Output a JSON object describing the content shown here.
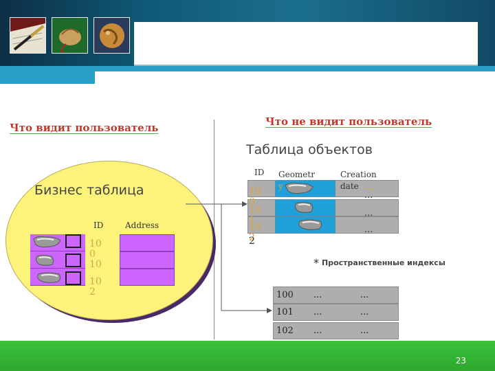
{
  "headings": {
    "visible": "Что видит пользователь",
    "hidden": "Что не видит пользователь"
  },
  "business_table": {
    "title": "Бизнес таблица",
    "columns": [
      "ID",
      "Address"
    ],
    "ids": [
      "10\n0",
      "10",
      "10\n2"
    ]
  },
  "object_table": {
    "title": "Таблица объектов",
    "columns": [
      "ID",
      "Geometr\ny",
      "Creation\ndate"
    ],
    "ids": [
      "10\n0",
      "10\n1",
      "10\n2"
    ],
    "ellipsis_highlight": "...",
    "ellipsis": "..."
  },
  "spatial_index": {
    "star": "*",
    "label": "Пространственные индексы",
    "rows": [
      {
        "id": "100",
        "a": "...",
        "b": "..."
      },
      {
        "id": "101",
        "a": "...",
        "b": "..."
      },
      {
        "id": "102",
        "a": "...",
        "b": "..."
      }
    ]
  },
  "footer": {
    "page_number": "23"
  },
  "colors": {
    "accent_header": "#0f5a78",
    "footer_green": "#2ea82e",
    "purple": "#cc66ff",
    "blue": "#1fa0d8",
    "yellow": "#fdf27a"
  }
}
